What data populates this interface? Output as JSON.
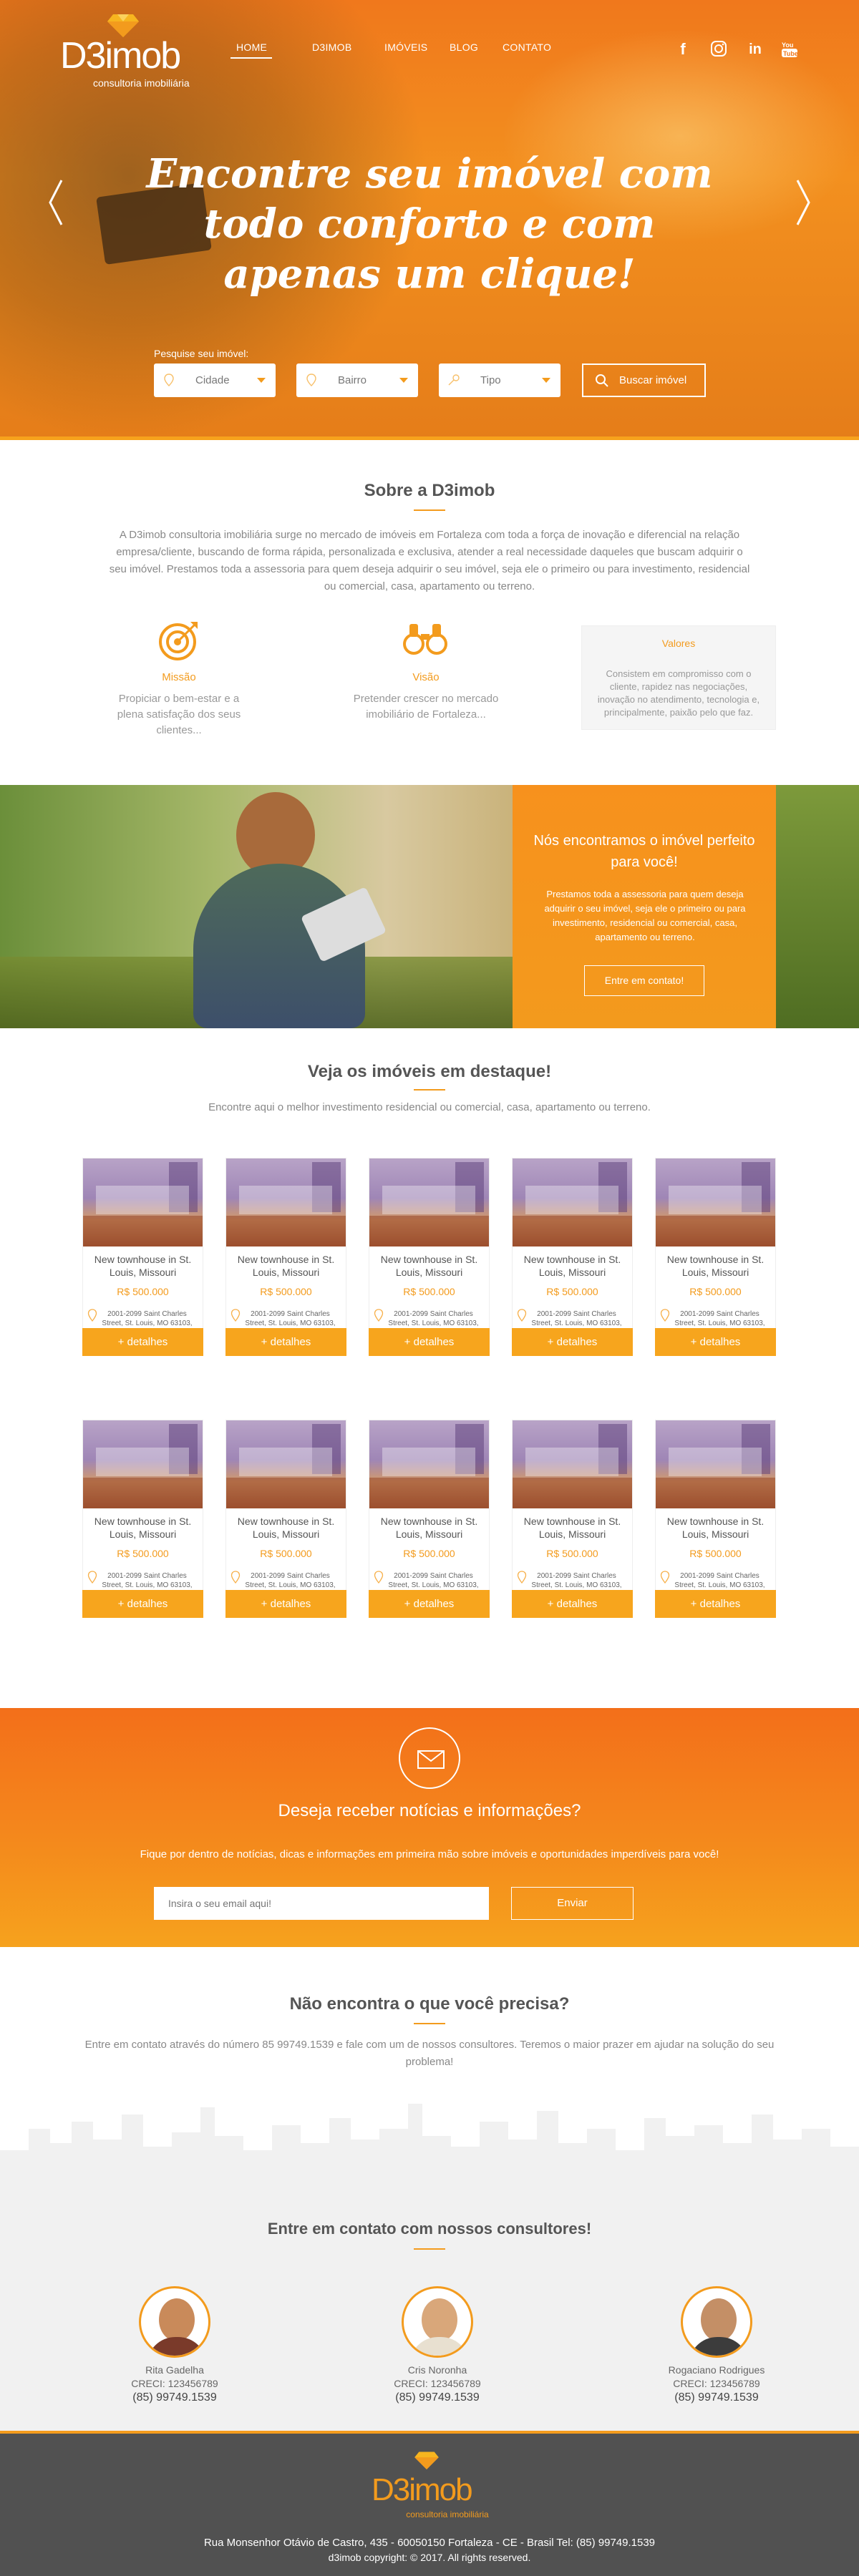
{
  "brand": {
    "logo": "D3imob",
    "tagline": "consultoria imobiliária"
  },
  "nav": {
    "items": [
      "HOME",
      "D3IMOB",
      "IMÓVEIS",
      "BLOG",
      "CONTATO"
    ],
    "active": "HOME"
  },
  "social": [
    "facebook-icon",
    "instagram-icon",
    "linkedin-icon",
    "youtube-icon"
  ],
  "hero": {
    "title": "Encontre seu imóvel com todo conforto e com apenas um clique!",
    "search_label": "Pesquise seu imóvel:",
    "selects": [
      "Cidade",
      "Bairro",
      "Tipo"
    ],
    "search_button": "Buscar imóvel"
  },
  "about": {
    "title": "Sobre a D3imob",
    "text": "A D3imob consultoria imobiliária surge no mercado de imóveis em Fortaleza com toda a força de inovação e diferencial na relação empresa/cliente, buscando de forma rápida, personalizada e exclusiva, atender a real necessidade daqueles que buscam adquirir o seu imóvel. Prestamos toda a assessoria para quem deseja adquirir o seu imóvel, seja ele o primeiro ou para investimento, residencial ou comercial, casa, apartamento ou terreno.",
    "features": [
      {
        "title": "Missão",
        "text": "Propiciar o bem-estar e a plena satisfação dos seus clientes..."
      },
      {
        "title": "Visão",
        "text": "Pretender crescer no mercado imobiliário de Fortaleza..."
      },
      {
        "title": "Valores",
        "text": "Consistem em compromisso com o cliente, rapidez nas negociações, inovação no atendimento, tecnologia e, principalmente, paixão pelo que faz."
      }
    ]
  },
  "promo": {
    "title": "Nós encontramos o imóvel perfeito para você!",
    "text": "Prestamos toda a assessoria para quem deseja adquirir o seu imóvel, seja ele o primeiro ou para investimento, residencial ou comercial, casa, apartamento ou terreno.",
    "button": "Entre em contato!"
  },
  "listings": {
    "title": "Veja os imóveis em destaque!",
    "subtitle": "Encontre aqui o melhor investimento residencial ou comercial, casa, apartamento ou terreno.",
    "cards": [
      {
        "title": "New townhouse in St. Louis, Missouri",
        "price": "R$ 500.000",
        "address": "2001-2099 Saint Charles Street, St. Louis, MO 63103, USA",
        "button": "+ detalhes"
      },
      {
        "title": "New townhouse in St. Louis, Missouri",
        "price": "R$ 500.000",
        "address": "2001-2099 Saint Charles Street, St. Louis, MO 63103, USA",
        "button": "+ detalhes"
      },
      {
        "title": "New townhouse in St. Louis, Missouri",
        "price": "R$ 500.000",
        "address": "2001-2099 Saint Charles Street, St. Louis, MO 63103, USA",
        "button": "+ detalhes"
      },
      {
        "title": "New townhouse in St. Louis, Missouri",
        "price": "R$ 500.000",
        "address": "2001-2099 Saint Charles Street, St. Louis, MO 63103, USA",
        "button": "+ detalhes"
      },
      {
        "title": "New townhouse in St. Louis, Missouri",
        "price": "R$ 500.000",
        "address": "2001-2099 Saint Charles Street, St. Louis, MO 63103, USA",
        "button": "+ detalhes"
      },
      {
        "title": "New townhouse in St. Louis, Missouri",
        "price": "R$ 500.000",
        "address": "2001-2099 Saint Charles Street, St. Louis, MO 63103, USA",
        "button": "+ detalhes"
      },
      {
        "title": "New townhouse in St. Louis, Missouri",
        "price": "R$ 500.000",
        "address": "2001-2099 Saint Charles Street, St. Louis, MO 63103, USA",
        "button": "+ detalhes"
      },
      {
        "title": "New townhouse in St. Louis, Missouri",
        "price": "R$ 500.000",
        "address": "2001-2099 Saint Charles Street, St. Louis, MO 63103, USA",
        "button": "+ detalhes"
      },
      {
        "title": "New townhouse in St. Louis, Missouri",
        "price": "R$ 500.000",
        "address": "2001-2099 Saint Charles Street, St. Louis, MO 63103, USA",
        "button": "+ detalhes"
      },
      {
        "title": "New townhouse in St. Louis, Missouri",
        "price": "R$ 500.000",
        "address": "2001-2099 Saint Charles Street, St. Louis, MO 63103, USA",
        "button": "+ detalhes"
      }
    ]
  },
  "newsletter": {
    "title": "Deseja receber notícias e informações?",
    "text": "Fique por dentro de notícias, dicas e informações em primeira mão sobre imóveis e oportunidades imperdíveis para você!",
    "placeholder": "Insira o seu email aqui!",
    "button": "Enviar"
  },
  "help": {
    "title": "Não encontra o que você precisa?",
    "text": "Entre em contato através do número 85 99749.1539 e fale com um de nossos consultores. Teremos o maior prazer em ajudar na solução do seu problema!"
  },
  "consultants": {
    "title": "Entre em contato com nossos consultores!",
    "people": [
      {
        "name": "Rita Gadelha",
        "creci": "CRECI: 123456789",
        "phone": "(85) 99749.1539"
      },
      {
        "name": "Cris Noronha",
        "creci": "CRECI: 123456789",
        "phone": "(85) 99749.1539"
      },
      {
        "name": "Rogaciano Rodrigues",
        "creci": "CRECI: 123456789",
        "phone": "(85) 99749.1539"
      }
    ]
  },
  "footer": {
    "logo": "D3imob",
    "tagline": "consultoria imobiliária",
    "address": "Rua Monsenhor Otávio de Castro, 435 - 60050150 Fortaleza - CE - Brasil Tel: (85) 99749.1539",
    "copyright": "d3imob copyright: © 2017. All rights reserved."
  },
  "colors": {
    "accent": "#f39b1d",
    "hero_orange": "#f0781c",
    "footer_bg": "#515151"
  }
}
